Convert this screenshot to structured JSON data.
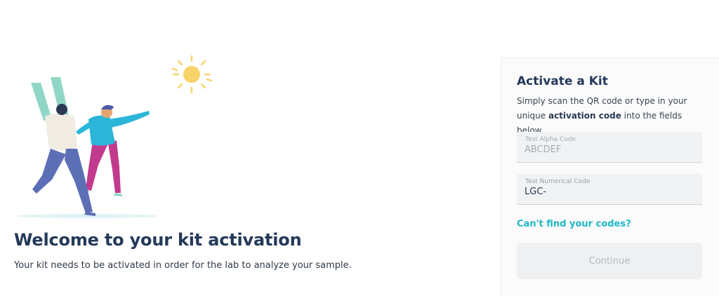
{
  "welcome": {
    "title": "Welcome to your kit activation",
    "subtitle": "Your kit needs to be activated in order for the lab to analyze your sample."
  },
  "card": {
    "title": "Activate a Kit",
    "description_pre": "Simply scan the QR code or type in your unique ",
    "description_bold": "activation code",
    "description_post": " into the fields below.",
    "fields": [
      {
        "label": "Test Alpha Code",
        "value": "ABCDEF",
        "disabled": true
      },
      {
        "label": "Test Numerical Code",
        "value": "LGC-",
        "disabled": false
      }
    ],
    "help_link": "Can't find your codes?",
    "continue_label": "Continue"
  },
  "colors": {
    "accent": "#1fb6c6",
    "title": "#24395a",
    "sun": "#f7d36a",
    "jacket": "#2bb5d8",
    "pants_left": "#5c6fb6",
    "pants_right": "#c23a8e",
    "arms_left": "#8fd6c6"
  },
  "illustration": {
    "icons": [
      "sun-icon",
      "people-illustration"
    ]
  }
}
